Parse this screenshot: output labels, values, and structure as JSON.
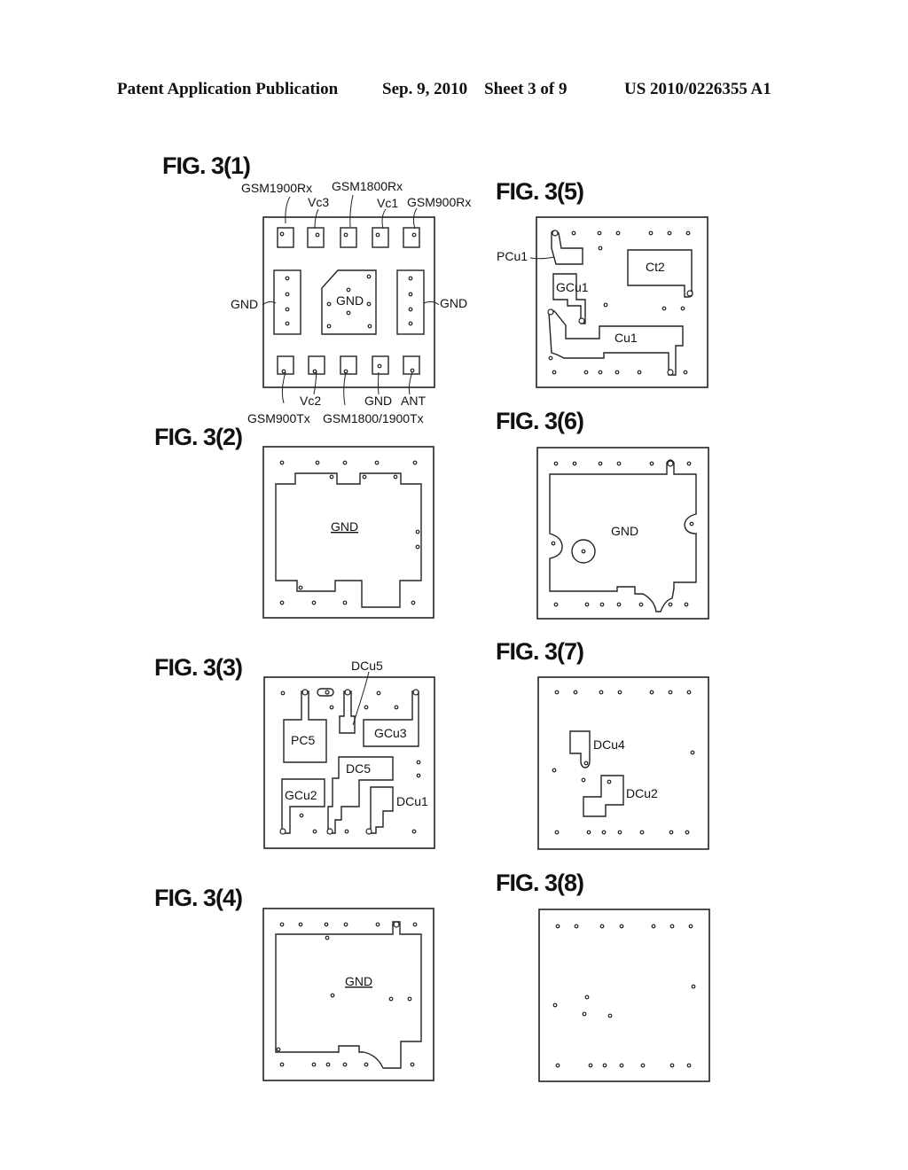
{
  "header": {
    "publication": "Patent Application Publication",
    "date_sheet": "Sep. 9, 2010    Sheet 3 of 9",
    "number": "US 2010/0226355 A1"
  },
  "figures": {
    "fig1": {
      "title": "FIG. 3(1)",
      "labels": {
        "gsm1900rx": "GSM1900Rx",
        "vc3": "Vc3",
        "gsm1800rx": "GSM1800Rx",
        "vc1": "Vc1",
        "gsm900rx": "GSM900Rx",
        "gnd_left": "GND",
        "gnd_center": "GND",
        "gnd_right": "GND",
        "vc2": "Vc2",
        "gnd_bottom": "GND",
        "ant": "ANT",
        "gsm900tx": "GSM900Tx",
        "gsm1800_1900tx": "GSM1800/1900Tx"
      }
    },
    "fig2": {
      "title": "FIG. 3(2)",
      "labels": {
        "gnd": "GND"
      }
    },
    "fig3": {
      "title": "FIG. 3(3)",
      "labels": {
        "dcu5": "DCu5",
        "pc5": "PC5",
        "gcu3": "GCu3",
        "dc5": "DC5",
        "gcu2": "GCu2",
        "dcu1": "DCu1"
      }
    },
    "fig4": {
      "title": "FIG. 3(4)",
      "labels": {
        "gnd": "GND"
      }
    },
    "fig5": {
      "title": "FIG. 3(5)",
      "labels": {
        "pcu1": "PCu1",
        "ct2": "Ct2",
        "gcu1": "GCu1",
        "cu1": "Cu1"
      }
    },
    "fig6": {
      "title": "FIG. 3(6)",
      "labels": {
        "gnd": "GND"
      }
    },
    "fig7": {
      "title": "FIG. 3(7)",
      "labels": {
        "dcu4": "DCu4",
        "dcu2": "DCu2"
      }
    },
    "fig8": {
      "title": "FIG. 3(8)",
      "labels": {}
    }
  }
}
